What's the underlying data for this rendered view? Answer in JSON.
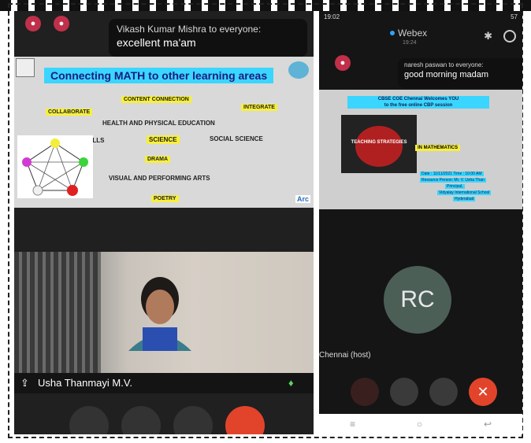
{
  "left": {
    "chat": {
      "from": "Vikash Kumar Mishra to everyone:",
      "message": "excellent ma'am"
    },
    "slide": {
      "title": "Connecting MATH to other learning areas",
      "keywords": [
        "CONTENT CONNECTION",
        "COLLABORATE",
        "INTEGRATE",
        "HEALTH AND PHYSICAL EDUCATION",
        "LANGUAGE SKILLS",
        "SCIENCE",
        "SOCIAL SCIENCE",
        "DRAMA",
        "VISUAL AND PERFORMING ARTS",
        "POETRY"
      ],
      "badge": "Arc"
    },
    "participant_name": "Usha Thanmayi M.V."
  },
  "right": {
    "status": {
      "time": "19:02",
      "battery": "57"
    },
    "app_title": "Webex",
    "app_sub": "19:24",
    "chat": {
      "from": "naresh paswan to everyone:",
      "message": "good morning madam"
    },
    "slide": {
      "title_line1": "CBSE COE Chennai  Welcomes YOU",
      "title_line2": "to the free online CBP session",
      "apple_text": "TEACHING STRATEGIES",
      "keyword": "IN MATHEMATICS",
      "info_lines": [
        "Date : 11/11/2021   Time : 10:00 AM",
        "Resource Person: Mr. V. Usha Than",
        "Principal,",
        "Vidyalay International School",
        "Hyderabad"
      ]
    },
    "avatar_initials": "RC",
    "host_label": "Chennai (host)"
  }
}
